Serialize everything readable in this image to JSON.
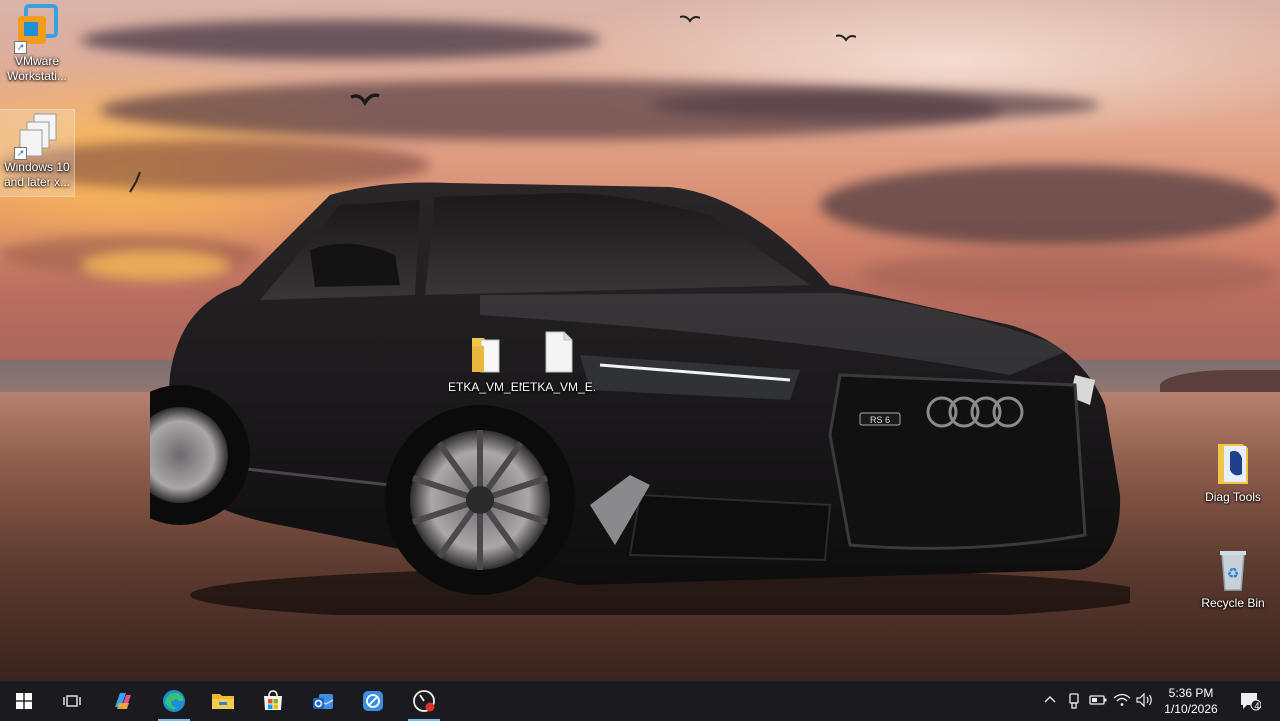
{
  "desktop": {
    "icons": [
      {
        "label": "VMware Workstati..."
      },
      {
        "label": "Windows 10 and later x..."
      },
      {
        "label": "ETKA_VM_EN"
      },
      {
        "label": "ETKA_VM_E..."
      },
      {
        "label": "Diag Tools"
      },
      {
        "label": "Recycle Bin"
      }
    ],
    "car_badge": "RS 6"
  },
  "taskbar": {
    "apps": [
      {
        "icon": "start-icon"
      },
      {
        "icon": "task-view-icon"
      },
      {
        "icon": "copilot-icon"
      },
      {
        "icon": "edge-icon"
      },
      {
        "icon": "file-explorer-icon"
      },
      {
        "icon": "microsoft-store-icon"
      },
      {
        "icon": "outlook-icon"
      },
      {
        "icon": "quick-assist-icon"
      },
      {
        "icon": "diagnostic-gauge-icon"
      }
    ],
    "clock": {
      "time": "5:36 PM",
      "date": "1/10/2026"
    },
    "notifications_count": "4"
  },
  "colors": {
    "taskbar_bg": "#1b1b1f",
    "accent": "#76b9ed"
  }
}
